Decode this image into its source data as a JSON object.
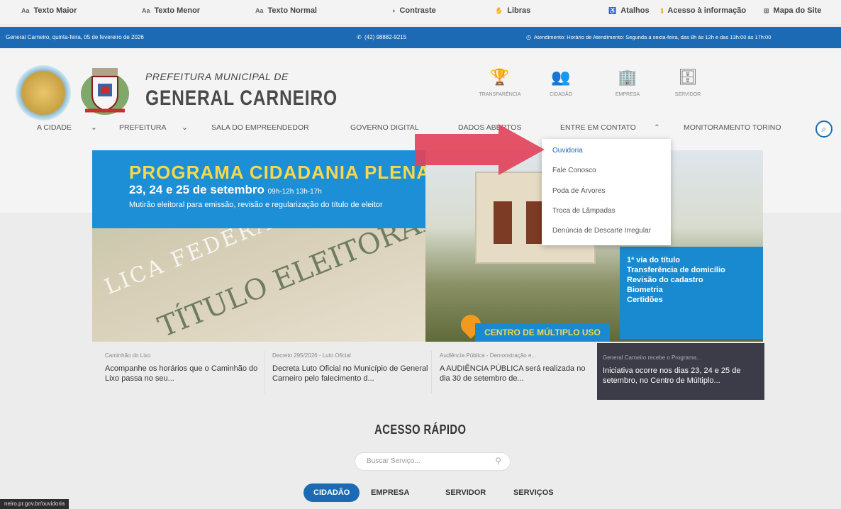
{
  "accessibility": {
    "texto_maior": "Texto Maior",
    "texto_menor": "Texto Menor",
    "texto_normal": "Texto Normal",
    "contraste": "Contraste",
    "libras": "Libras",
    "atalhos": "Atalhos",
    "acesso_info": "Acesso à informação",
    "mapa_site": "Mapa do Site",
    "font_icon_label": "AA"
  },
  "infobar": {
    "date": "General Carneiro, quinta-feira, 05 de fevereiro de 2026",
    "phone": "(42) 98882-9215",
    "hours": "Atendimento: Horário de Atendimento: Segunda a sexta-feira, das 8h às 12h e das 13h:00 às 17h:00"
  },
  "brand": {
    "line1": "PREFEITURA MUNICIPAL DE",
    "line2": "GENERAL CARNEIRO"
  },
  "header_icons": [
    {
      "label": "TRANSPARÊNCIA",
      "icon": "trophy-icon"
    },
    {
      "label": "CIDADÃO",
      "icon": "people-icon"
    },
    {
      "label": "EMPRESA",
      "icon": "building-icon"
    },
    {
      "label": "SERVIDOR",
      "icon": "server-icon"
    }
  ],
  "nav": {
    "cidade": "A CIDADE",
    "prefeitura": "PREFEITURA",
    "sala": "SALA DO EMPREENDEDOR",
    "governo": "GOVERNO DIGITAL",
    "dados": "DADOS ABERTOS",
    "contato": "ENTRE EM CONTATO",
    "monitoramento": "MONITORAMENTO TORINO"
  },
  "dropdown": {
    "items": [
      "Ouvidoria",
      "Fale Conosco",
      "Poda de Árvores",
      "Troca de Lâmpadas",
      "Denúncia de Descarte Irregular"
    ]
  },
  "banner": {
    "title": "PROGRAMA CIDADANIA PLENA",
    "date": "23, 24 e 25 de setembro",
    "hours": "09h-12h 13h-17h",
    "subtitle": "Mutirão eleitoral para emissão, revisão e regularização do título de eleitor",
    "document_text": "TÍTULO ELEITORAL",
    "federal_text": "LICA FEDERA",
    "list": [
      "1ª via do título",
      "Transferência de domicílio",
      "Revisão do cadastro",
      "Biometria",
      "Certidões"
    ],
    "place": "CENTRO DE MÚLTIPLO USO"
  },
  "news": [
    {
      "section": "Caminhão do Lixo",
      "text": "Acompanhe os horários que o Caminhão do Lixo passa no seu..."
    },
    {
      "section": "Decreto 295/2026 - Luto Oficial",
      "text": "Decreta Luto Oficial no Município de General Carneiro pelo falecimento d..."
    },
    {
      "section": "Audiência Pública - Demonstração e...",
      "text": "A AUDIÊNCIA PÚBLICA será realizada no dia 30 de setembro de..."
    },
    {
      "section": "General Carneiro recebe o Programa...",
      "text": "Iniciativa ocorre nos dias 23, 24 e 25 de setembro, no Centro de Múltiplo..."
    }
  ],
  "quick_access": {
    "title": "ACESSO RÁPIDO",
    "search_placeholder": "Buscar Serviço...",
    "tabs": [
      "CIDADÃO",
      "EMPRESA",
      "SERVIDOR",
      "SERVIÇOS"
    ]
  },
  "statusbar": {
    "url": "neiro.pr.gov.br/ouvidoria"
  },
  "colors": {
    "primary_blue": "#1c6ab4",
    "banner_yellow": "#f7d84a",
    "arrow_red": "#e1435a"
  }
}
